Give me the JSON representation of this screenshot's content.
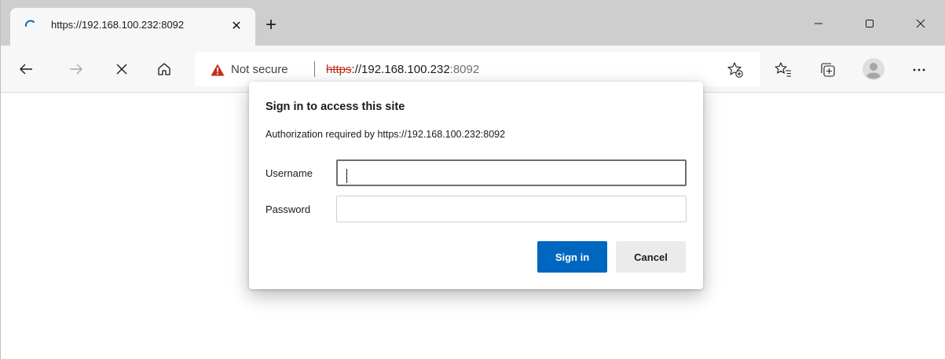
{
  "tab": {
    "title": "https://192.168.100.232:8092",
    "close_icon": "close-icon",
    "loading_icon": "loading-spinner-icon"
  },
  "new_tab_icon": "plus-icon",
  "window_controls": [
    "minimize-icon",
    "maximize-icon",
    "close-icon"
  ],
  "nav": {
    "back_icon": "back-arrow-icon",
    "forward_icon": "forward-arrow-icon",
    "stop_icon": "stop-icon",
    "home_icon": "home-icon"
  },
  "address_bar": {
    "security_label": "Not secure",
    "url_scheme": "https",
    "url_sep": "://",
    "url_host": "192.168.100.232",
    "url_port": ":8092",
    "warning_icon": "warning-triangle-icon",
    "warning_color": "#c42b1c",
    "add_favorite_icon": "add-favorite-icon"
  },
  "toolbar_icons": [
    "favorites-icon",
    "collections-icon",
    "profile-avatar-icon",
    "more-options-icon"
  ],
  "dialog": {
    "title": "Sign in to access this site",
    "subtitle": "Authorization required by https://192.168.100.232:8092",
    "username_label": "Username",
    "username_value": "",
    "password_label": "Password",
    "password_value": "",
    "sign_in_label": "Sign in",
    "cancel_label": "Cancel",
    "primary_color": "#0067c0"
  }
}
